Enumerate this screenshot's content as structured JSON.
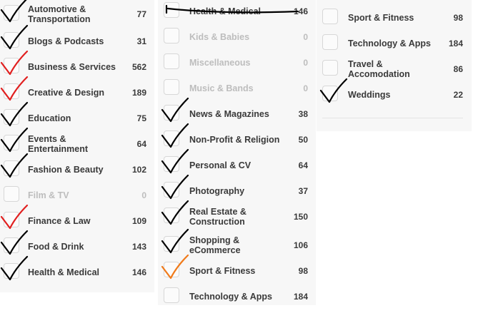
{
  "columns": [
    {
      "items": [
        {
          "label": "Automotive & Transportation",
          "count": "77",
          "checked": true,
          "mark_color": "#000000"
        },
        {
          "label": "Blogs & Podcasts",
          "count": "31",
          "checked": true,
          "mark_color": "#000000"
        },
        {
          "label": "Business & Services",
          "count": "562",
          "checked": true,
          "mark_color": "#e11f1f"
        },
        {
          "label": "Creative & Design",
          "count": "189",
          "checked": true,
          "mark_color": "#e11f1f"
        },
        {
          "label": "Education",
          "count": "75",
          "checked": true,
          "mark_color": "#000000"
        },
        {
          "label": "Events & Entertainment",
          "count": "64",
          "checked": true,
          "mark_color": "#000000"
        },
        {
          "label": "Fashion & Beauty",
          "count": "102",
          "checked": true,
          "mark_color": "#000000"
        },
        {
          "label": "Film & TV",
          "count": "0",
          "checked": false,
          "disabled": true
        },
        {
          "label": "Finance & Law",
          "count": "109",
          "checked": true,
          "mark_color": "#e11f1f"
        },
        {
          "label": "Food & Drink",
          "count": "143",
          "checked": true,
          "mark_color": "#000000"
        },
        {
          "label": "Health & Medical",
          "count": "146",
          "checked": true,
          "mark_color": "#000000"
        }
      ]
    },
    {
      "items": [
        {
          "label": "Health & Medical",
          "count": "146",
          "checked": false,
          "struck": true,
          "mark_color": "#000000"
        },
        {
          "label": "Kids & Babies",
          "count": "0",
          "checked": false,
          "disabled": true
        },
        {
          "label": "Miscellaneous",
          "count": "0",
          "checked": false,
          "disabled": true
        },
        {
          "label": "Music & Bands",
          "count": "0",
          "checked": false,
          "disabled": true
        },
        {
          "label": "News & Magazines",
          "count": "38",
          "checked": true,
          "mark_color": "#000000"
        },
        {
          "label": "Non-Profit & Religion",
          "count": "50",
          "checked": true,
          "mark_color": "#000000"
        },
        {
          "label": "Personal & CV",
          "count": "64",
          "checked": true,
          "mark_color": "#000000"
        },
        {
          "label": "Photography",
          "count": "37",
          "checked": true,
          "mark_color": "#000000"
        },
        {
          "label": "Real Estate & Construction",
          "count": "150",
          "checked": true,
          "mark_color": "#000000"
        },
        {
          "label": "Shopping & eCommerce",
          "count": "106",
          "checked": true,
          "mark_color": "#000000"
        },
        {
          "label": "Sport & Fitness",
          "count": "98",
          "checked": true,
          "mark_color": "#f07a1a"
        },
        {
          "label": "Technology & Apps",
          "count": "184",
          "checked": false
        }
      ]
    },
    {
      "items": [
        {
          "label": "Sport & Fitness",
          "count": "98",
          "checked": false
        },
        {
          "label": "Technology & Apps",
          "count": "184",
          "checked": false
        },
        {
          "label": "Travel & Accomodation",
          "count": "86",
          "checked": false
        },
        {
          "label": "Weddings",
          "count": "22",
          "checked": true,
          "mark_color": "#000000"
        }
      ]
    }
  ]
}
